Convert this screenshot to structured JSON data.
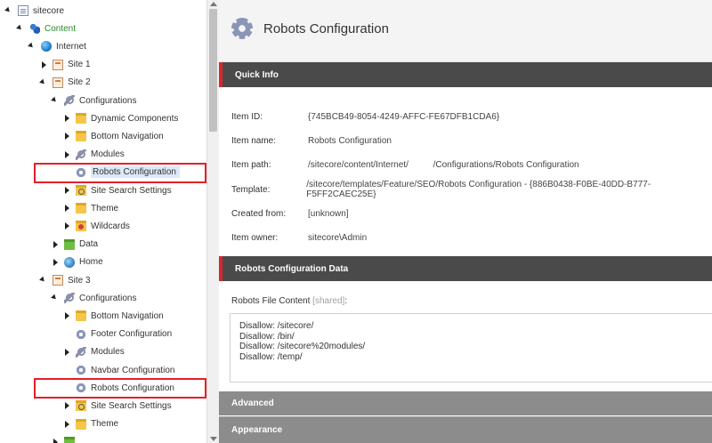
{
  "tree": {
    "nodes": [
      {
        "label": "sitecore",
        "icon": "document-icon",
        "toggle": "open",
        "indent": 0,
        "row": 0
      },
      {
        "label": "Content",
        "icon": "content-icon",
        "toggle": "open",
        "indent": 1,
        "row": 1
      },
      {
        "label": "Internet",
        "icon": "globe-icon",
        "toggle": "open",
        "indent": 2,
        "row": 2
      },
      {
        "label": "Site 1",
        "icon": "site-icon",
        "toggle": "closed",
        "indent": 3,
        "row": 3
      },
      {
        "label": "Site 2",
        "icon": "site-icon",
        "toggle": "open",
        "indent": 3,
        "row": 4
      },
      {
        "label": "Configurations",
        "icon": "wrench-icon",
        "toggle": "open",
        "indent": 4,
        "row": 5
      },
      {
        "label": "Dynamic Components",
        "icon": "folder-icon",
        "toggle": "closed",
        "indent": 5,
        "row": 6
      },
      {
        "label": "Bottom Navigation",
        "icon": "folder-icon",
        "toggle": "closed",
        "indent": 5,
        "row": 7
      },
      {
        "label": "Modules",
        "icon": "wrench-icon",
        "toggle": "closed",
        "indent": 5,
        "row": 8
      },
      {
        "label": "Robots Configuration",
        "icon": "gear-icon",
        "toggle": "none",
        "indent": 5,
        "row": 9,
        "selected": true,
        "highlighted": true
      },
      {
        "label": "Site Search Settings",
        "icon": "search-folder-icon",
        "toggle": "closed",
        "indent": 5,
        "row": 10
      },
      {
        "label": "Theme",
        "icon": "folder-icon",
        "toggle": "closed",
        "indent": 5,
        "row": 11
      },
      {
        "label": "Wildcards",
        "icon": "wildcard-folder-icon",
        "toggle": "closed",
        "indent": 5,
        "row": 12
      },
      {
        "label": "Data",
        "icon": "data-folder-icon",
        "toggle": "closed",
        "indent": 4,
        "row": 13
      },
      {
        "label": "Home",
        "icon": "home-icon",
        "toggle": "closed",
        "indent": 4,
        "row": 14
      },
      {
        "label": "Site 3",
        "icon": "site-icon",
        "toggle": "open",
        "indent": 3,
        "row": 15
      },
      {
        "label": "Configurations",
        "icon": "wrench-icon",
        "toggle": "open",
        "indent": 4,
        "row": 16
      },
      {
        "label": "Bottom Navigation",
        "icon": "folder-icon",
        "toggle": "closed",
        "indent": 5,
        "row": 17
      },
      {
        "label": "Footer Configuration",
        "icon": "gear-icon",
        "toggle": "none",
        "indent": 5,
        "row": 18
      },
      {
        "label": "Modules",
        "icon": "wrench-icon",
        "toggle": "closed",
        "indent": 5,
        "row": 19
      },
      {
        "label": "Navbar Configuration",
        "icon": "gear-icon",
        "toggle": "none",
        "indent": 5,
        "row": 20
      },
      {
        "label": "Robots Configuration",
        "icon": "gear-icon",
        "toggle": "none",
        "indent": 5,
        "row": 21,
        "highlighted": true
      },
      {
        "label": "Site Search Settings",
        "icon": "search-folder-icon",
        "toggle": "closed",
        "indent": 5,
        "row": 22
      },
      {
        "label": "Theme",
        "icon": "folder-icon",
        "toggle": "closed",
        "indent": 5,
        "row": 23
      },
      {
        "label": "",
        "icon": "data-folder-icon",
        "toggle": "closed",
        "indent": 4,
        "row": 24
      }
    ]
  },
  "header": {
    "title": "Robots Configuration",
    "icon": "gear-icon"
  },
  "quick_info": {
    "heading": "Quick Info",
    "rows": [
      {
        "label": "Item ID:",
        "value": "{745BCB49-8054-4249-AFFC-FE67DFB1CDA6}"
      },
      {
        "label": "Item name:",
        "value": "Robots Configuration"
      },
      {
        "label": "Item path:",
        "value": "/sitecore/content/Internet/          /Configurations/Robots Configuration"
      },
      {
        "label": "Template:",
        "value": "/sitecore/templates/Feature/SEO/Robots Configuration - {886B0438-F0BE-40DD-B777-F5FF2CAEC25E}"
      },
      {
        "label": "Created from:",
        "value": "[unknown]"
      },
      {
        "label": "Item owner:",
        "value": "sitecore\\Admin"
      }
    ]
  },
  "robots_section": {
    "heading": "Robots Configuration Data",
    "field_label": "Robots File Content",
    "field_shared": "[shared]",
    "field_suffix": ":",
    "lines": [
      "Disallow: /sitecore/",
      "Disallow: /bin/",
      "Disallow: /sitecore%20modules/",
      "Disallow: /temp/"
    ]
  },
  "collapsed_sections": {
    "advanced": "Advanced",
    "appearance": "Appearance"
  },
  "colors": {
    "accent_red": "#d9262e",
    "section_dark": "#4a4a4a",
    "section_gray": "#8c8c8c",
    "selection_blue": "#dbe9f8"
  }
}
